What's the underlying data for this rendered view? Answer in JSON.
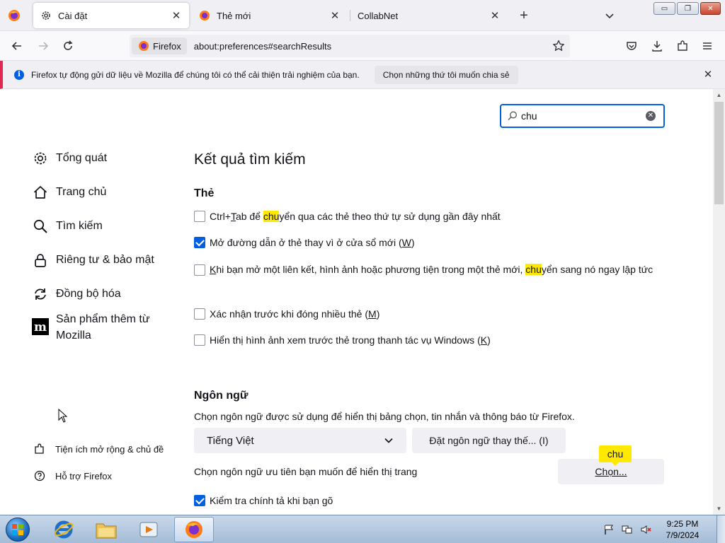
{
  "tabs": [
    {
      "label": "Cài đặt",
      "active": true
    },
    {
      "label": "Thẻ mới",
      "active": false
    },
    {
      "label": "CollabNet",
      "active": false
    }
  ],
  "window_controls": {
    "minimize": "▭",
    "restore": "❐",
    "close": "✕"
  },
  "urlbar": {
    "identity_label": "Firefox",
    "url": "about:preferences#searchResults"
  },
  "notification": {
    "text": "Firefox tự động gửi dữ liệu về Mozilla để chúng tôi có thể cải thiện trải nghiệm của bạn.",
    "button_label": "Chọn những thứ tôi muốn chia sẻ"
  },
  "search": {
    "value": "chu"
  },
  "sidebar": {
    "categories": [
      {
        "label": "Tổng quát",
        "icon": "gear-icon"
      },
      {
        "label": "Trang chủ",
        "icon": "home-icon"
      },
      {
        "label": "Tìm kiếm",
        "icon": "search-icon"
      },
      {
        "label": "Riêng tư & bảo mật",
        "icon": "lock-icon"
      },
      {
        "label": "Đồng bộ hóa",
        "icon": "sync-icon"
      },
      {
        "label": "Sản phẩm thêm từ Mozilla",
        "icon": "mozilla-m-icon"
      }
    ],
    "footer_links": [
      {
        "label": "Tiện ích mở rộng & chủ đề",
        "icon": "puzzle-icon"
      },
      {
        "label": "Hỗ trợ Firefox",
        "icon": "help-icon"
      }
    ]
  },
  "main": {
    "title": "Kết quả tìm kiếm",
    "tabs_section": {
      "heading": "Thẻ",
      "options": [
        {
          "pre": "Ctrl+",
          "u": "T",
          "mid": "ab để ",
          "hl": "chu",
          "post": "yển qua các thẻ theo thứ tự sử dụng gần đây nhất",
          "checked": false
        },
        {
          "text": "Mở đường dẫn ở thẻ thay vì ở cửa sổ mới (",
          "u": "W",
          "end": ")",
          "checked": true
        },
        {
          "pre": "",
          "u": "K",
          "mid": "hi bạn mở một liên kết, hình ảnh hoặc phương tiện trong một thẻ mới, ",
          "hl": "chu",
          "post": "yển sang nó ngay lập tức",
          "checked": false
        },
        {
          "text": "Xác nhận trước khi đóng nhiều thẻ (",
          "u": "M",
          "end": ")",
          "checked": false
        },
        {
          "text": "Hiển thị hình ảnh xem trước thẻ trong thanh tác vụ Windows (",
          "u": "K",
          "end": ")",
          "checked": false
        }
      ]
    },
    "language_section": {
      "heading": "Ngôn ngữ",
      "description": "Chọn ngôn ngữ được sử dụng để hiển thị bảng chọn, tin nhắn và thông báo từ Firefox.",
      "selected_language": "Tiếng Việt",
      "alt_button": "Đặt ngôn ngữ thay thế... (I)",
      "page_lang_text": "Chọn ngôn ngữ ưu tiên bạn muốn để hiển thị trang",
      "choose_button": "Chọn...",
      "choose_tooltip": "chu",
      "spellcheck_label": "Kiểm tra chính tả khi bạn gõ",
      "spellcheck_checked": true
    }
  },
  "taskbar": {
    "clock_time": "9:25 PM",
    "clock_date": "7/9/2024"
  },
  "colors": {
    "accent": "#0060df",
    "highlight": "#ffe900",
    "notice_stripe": "#e22850"
  }
}
